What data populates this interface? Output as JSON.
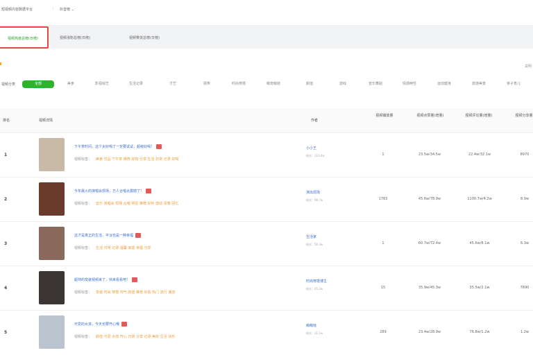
{
  "breadcrumb": {
    "first": "短视频内容数据平台",
    "sep": "|",
    "second": "抖音榜 ⌄"
  },
  "tabs": [
    {
      "label": "视频热度总榜(日榜)"
    },
    {
      "label": "视频涨粉总榜(日榜)"
    },
    {
      "label": "视频带货总榜(日榜)"
    }
  ],
  "notice_right": "说明",
  "filter": {
    "label": "视频分类",
    "options": [
      "全部",
      "美食",
      "影视综艺",
      "生活记录",
      "才艺",
      "搞笑",
      "时尚穿搭",
      "萌宠萌娃",
      "颜值",
      "游戏",
      "音乐舞蹈",
      "情感两性",
      "运动健身",
      "旅游美景",
      "亲子育儿"
    ]
  },
  "table": {
    "headers": [
      "排名",
      "视频详情",
      "作者",
      "视频播放量",
      "视频点赞量(增量)",
      "视频评论量(增量)",
      "视频分享量"
    ],
    "rows": [
      {
        "rank": "1",
        "title": "下午茶时间，这个太好喝了一定要试试，超级好喝！",
        "sub_label": "视频标签：",
        "sub_tag": "美食 饮品 下午茶 推荐 好物 分享 生活 日常 记录 好喝",
        "author": "小小王",
        "author_sub": "粉丝：123.4w",
        "col1": "1",
        "col2": "23.5w/34.5w",
        "col3": "22.4w/32.1w",
        "col4": "8970",
        "color": "#c9b9a7"
      },
      {
        "rank": "2",
        "title": "今年最火的演唱会现场，万人合唱太震撼了！",
        "sub_label": "视频标签：",
        "sub_tag": "音乐 演唱会 现场 合唱 明星 推荐 好听 感动 青春 回忆",
        "author": "演出现场",
        "author_sub": "粉丝：98.7w",
        "col1": "1783",
        "col2": "45.6w/78.9w",
        "col3": "1100.7w/4.2w",
        "col4": "8.9w",
        "color": "#6a3b2b"
      },
      {
        "rank": "3",
        "title": "这才是真正的生活，平淡也是一种幸福",
        "sub_label": "视频标签：",
        "sub_tag": "生活 日常 记录 温馨 家庭 幸福 分享",
        "author": "生活家",
        "author_sub": "粉丝：56.3w",
        "col1": "1",
        "col2": "60.7w/72.4w",
        "col3": "45.6w/8.1w",
        "col4": "6.3w",
        "color": "#8a6a5c"
      },
      {
        "rank": "4",
        "title": "超帅的变装视频来了，快来看看吧！",
        "sub_label": "视频标签：",
        "sub_tag": "变装 时尚 穿搭 帅气 颜值 推荐 好看 热门 流行 潮流",
        "author": "时尚穿搭博主",
        "author_sub": "粉丝：45.2w",
        "col1": "15",
        "col2": "35.9w/45.3w",
        "col3": "35.5w/2.1w",
        "col4": "7890",
        "color": "#3b3634"
      },
      {
        "rank": "5",
        "title": "可爱的女孩，今天也要开心哦",
        "sub_label": "视频标签：",
        "sub_tag": "颜值 可爱 女孩 开心 日常 分享 记录 美好 生活 快乐",
        "author": "萌萌哒",
        "author_sub": "粉丝：32.1w",
        "col1": "289",
        "col2": "23.4w/28.9w",
        "col3": "76.8w/1.2w",
        "col4": "1.2w",
        "color": "#b9c4cf"
      }
    ]
  }
}
